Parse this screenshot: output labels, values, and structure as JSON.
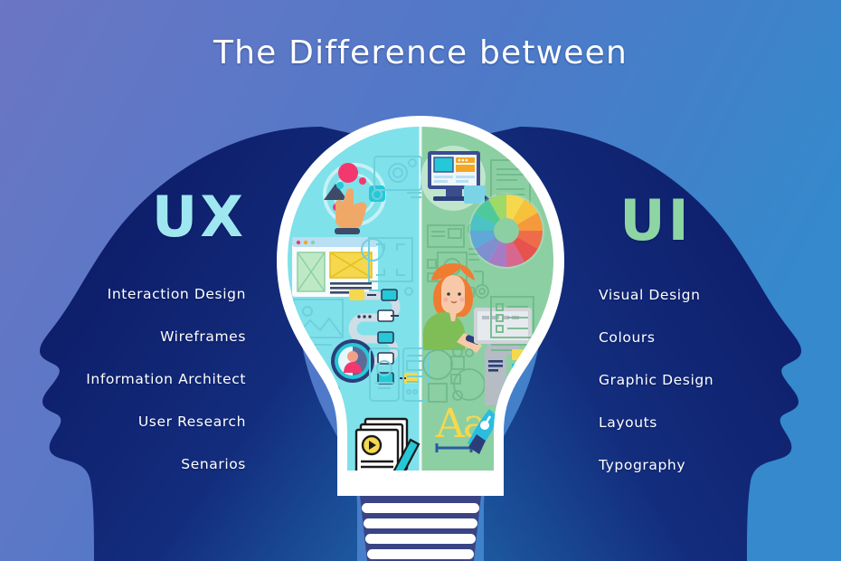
{
  "title": "The Difference between",
  "background": {
    "gradient_from": "#6b76c4",
    "gradient_to": "#3589cc"
  },
  "left": {
    "heading": "UX",
    "heading_color": "#9fe7f0",
    "silhouette_color_from": "#0f1f6e",
    "silhouette_color_to": "#1b4f96",
    "items": [
      "Interaction Design",
      "Wireframes",
      "Information Architect",
      "User Research",
      "Senarios"
    ]
  },
  "right": {
    "heading": "UI",
    "heading_color": "#8ed5a4",
    "silhouette_color_from": "#1b4f96",
    "silhouette_color_to": "#0f2a72",
    "items": [
      "Visual Design",
      "Colours",
      "Graphic Design",
      "Layouts",
      "Typography"
    ]
  },
  "bulb": {
    "outline_color": "#ffffff",
    "left_half_color": "#7fe1ea",
    "right_half_color": "#8ccfa3",
    "base_color": "#3a4485",
    "base_ring_color": "#ffffff",
    "left_icons": [
      "touch-interaction-icon",
      "camera-outline-icon",
      "wireframe-browser-icon",
      "crop-frame-icon",
      "image-placeholder-icon",
      "user-flow-diagram-icon",
      "user-research-magnifier-icon",
      "mobile-wireframe-icon",
      "scenario-document-icon"
    ],
    "right_icons": [
      "desktop-design-monitor-icon",
      "text-document-icon",
      "blueprint-layout-icon",
      "color-wheel-icon",
      "designer-person-icon",
      "checklist-icon",
      "shapes-outline-icon",
      "ui-component-panel-icon",
      "typography-pen-icon"
    ]
  }
}
